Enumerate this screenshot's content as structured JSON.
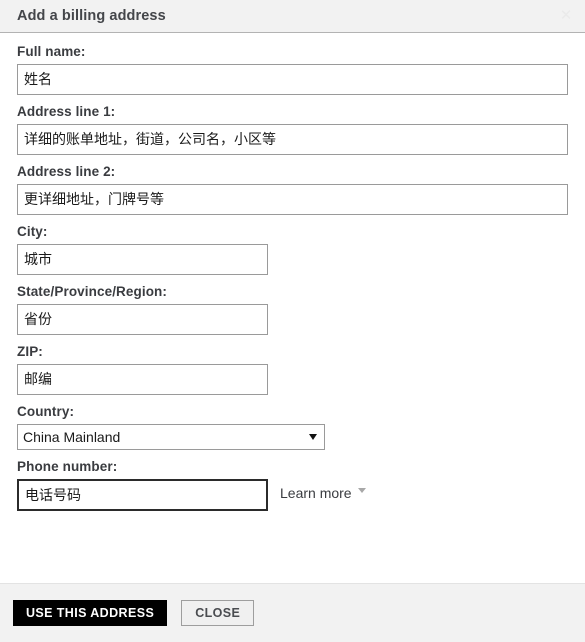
{
  "dialog": {
    "title": "Add a billing address",
    "close_icon": "close-icon",
    "close_glyph": "✕"
  },
  "form": {
    "fields": [
      {
        "label": "Full name:",
        "value": "姓名",
        "name": "full-name",
        "size": "wide"
      },
      {
        "label": "Address line 1:",
        "value": "详细的账单地址，街道，公司名，小区等",
        "name": "address-line-1",
        "size": "wide"
      },
      {
        "label": "Address line 2:",
        "value": "更详细地址，门牌号等",
        "name": "address-line-2",
        "size": "wide"
      },
      {
        "label": "City:",
        "value": "城市",
        "name": "city",
        "size": "narrow"
      },
      {
        "label": "State/Province/Region:",
        "value": "省份",
        "name": "state",
        "size": "narrow"
      },
      {
        "label": "ZIP:",
        "value": "邮编",
        "name": "zip",
        "size": "narrow"
      }
    ],
    "country": {
      "label": "Country:",
      "selected": "China Mainland",
      "options": [
        "China Mainland"
      ],
      "caret_icon": "chevron-down-icon"
    },
    "phone": {
      "label": "Phone number:",
      "value": "电话号码",
      "learn_more": "Learn more",
      "learn_more_caret_icon": "chevron-down-icon"
    }
  },
  "footer": {
    "primary_label": "USE THIS ADDRESS",
    "secondary_label": "CLOSE"
  },
  "colors": {
    "header_bg": "#f2f2f2",
    "footer_bg": "#f2f2f2",
    "primary_btn_bg": "#000000",
    "input_border": "#9a9a9a",
    "focus_border": "#2b2b2b",
    "label_text": "#3a3c40"
  }
}
